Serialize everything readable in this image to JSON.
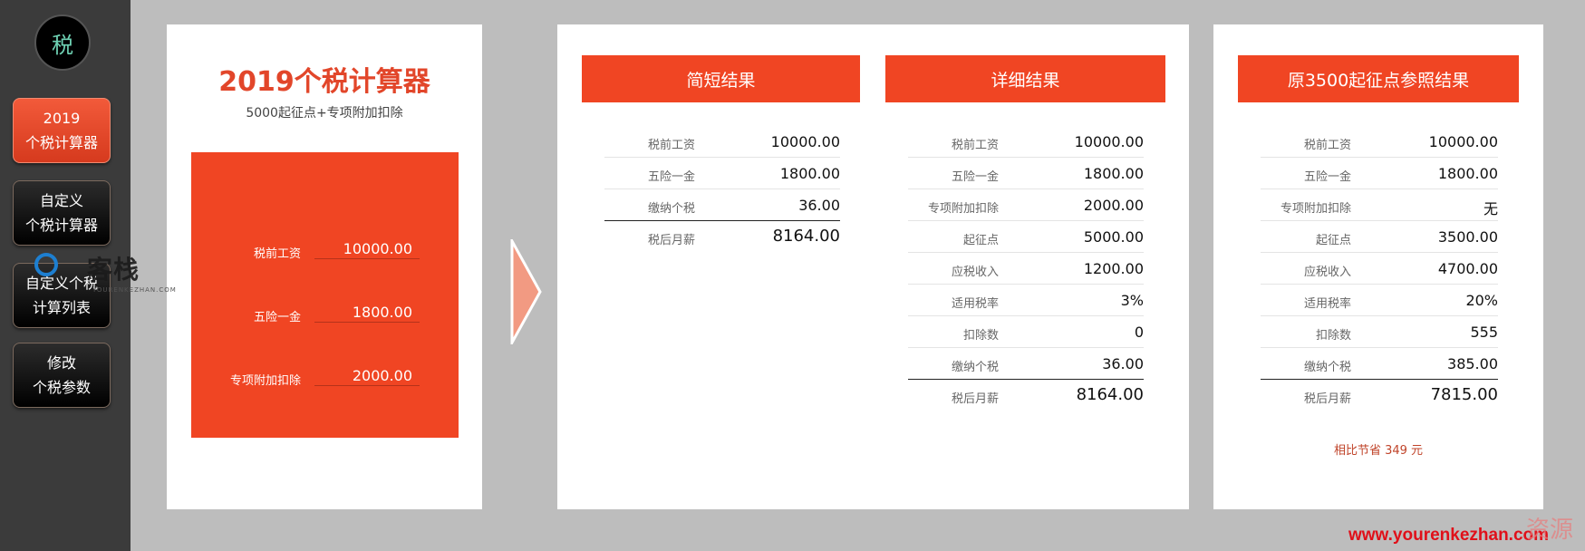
{
  "sidebar": {
    "logo": "税",
    "nav": [
      {
        "line1": "2019",
        "line2": "个税计算器"
      },
      {
        "line1": "自定义",
        "line2": "个税计算器"
      },
      {
        "line1": "自定义个税",
        "line2": "计算列表"
      },
      {
        "line1": "修改",
        "line2": "个税参数"
      }
    ]
  },
  "calculator": {
    "title": "2019个税计算器",
    "subtitle": "5000起征点+专项附加扣除",
    "inputs": [
      {
        "label": "税前工资",
        "value": "10000.00"
      },
      {
        "label": "五险一金",
        "value": "1800.00"
      },
      {
        "label": "专项附加扣除",
        "value": "2000.00"
      }
    ]
  },
  "short_result": {
    "header": "简短结果",
    "rows": [
      {
        "label": "税前工资",
        "value": "10000.00"
      },
      {
        "label": "五险一金",
        "value": "1800.00"
      },
      {
        "label": "缴纳个税",
        "value": "36.00"
      },
      {
        "label": "税后月薪",
        "value": "8164.00"
      }
    ]
  },
  "detail_result": {
    "header": "详细结果",
    "rows": [
      {
        "label": "税前工资",
        "value": "10000.00"
      },
      {
        "label": "五险一金",
        "value": "1800.00"
      },
      {
        "label": "专项附加扣除",
        "value": "2000.00"
      },
      {
        "label": "起征点",
        "value": "5000.00"
      },
      {
        "label": "应税收入",
        "value": "1200.00"
      },
      {
        "label": "适用税率",
        "value": "3%"
      },
      {
        "label": "扣除数",
        "value": "0"
      },
      {
        "label": "缴纳个税",
        "value": "36.00"
      },
      {
        "label": "税后月薪",
        "value": "8164.00"
      }
    ]
  },
  "ref_result": {
    "header": "原3500起征点参照结果",
    "rows": [
      {
        "label": "税前工资",
        "value": "10000.00"
      },
      {
        "label": "五险一金",
        "value": "1800.00"
      },
      {
        "label": "专项附加扣除",
        "value": "无"
      },
      {
        "label": "起征点",
        "value": "3500.00"
      },
      {
        "label": "应税收入",
        "value": "4700.00"
      },
      {
        "label": "适用税率",
        "value": "20%"
      },
      {
        "label": "扣除数",
        "value": "555"
      },
      {
        "label": "缴纳个税",
        "value": "385.00"
      },
      {
        "label": "税后月薪",
        "value": "7815.00"
      }
    ],
    "savings": "相比节省 349 元"
  },
  "watermarks": {
    "left_text": "客栈",
    "left_sub": "YOURENKEZHAN.COM",
    "right_url": "www.yourenkezhan.com",
    "right_mark": "资源"
  },
  "colors": {
    "accent": "#f04523",
    "sidebar": "#3b3b3b",
    "background": "#bdbdbd"
  }
}
